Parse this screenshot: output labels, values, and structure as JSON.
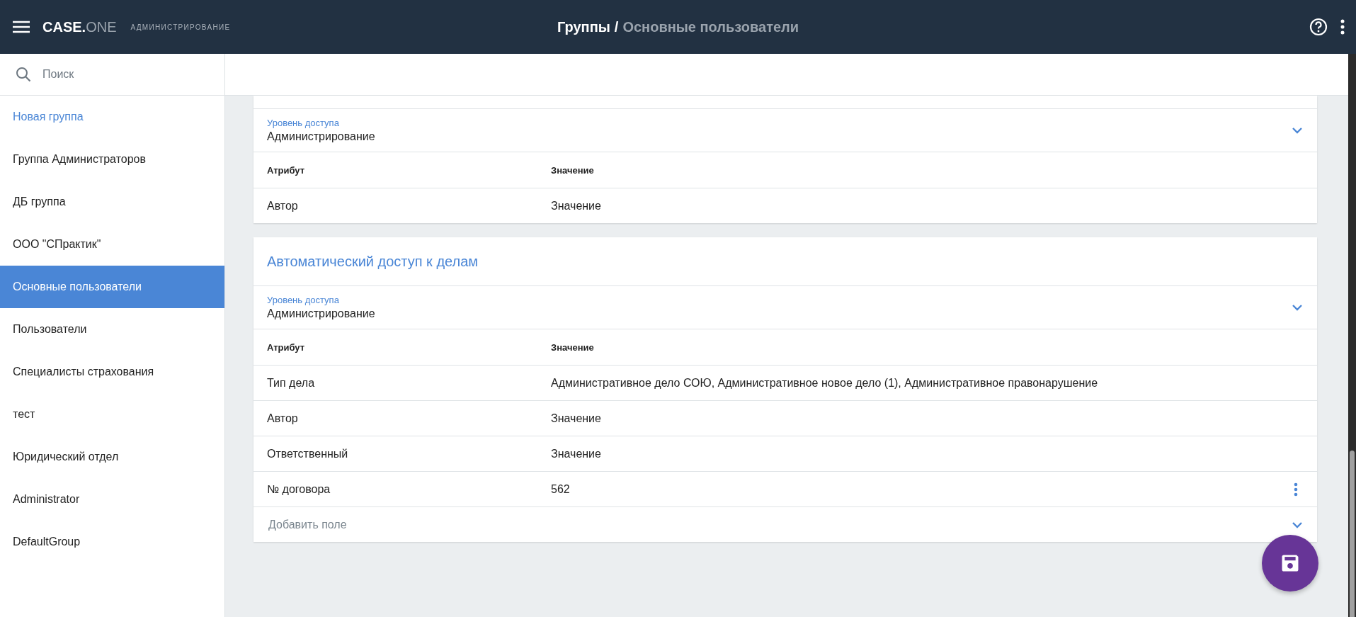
{
  "header": {
    "logo": {
      "main": "CASE.",
      "accent": "ONE"
    },
    "subtitle": "АДМИНИСТРИРОВАНИЕ",
    "breadcrumb": {
      "parent": "Группы",
      "separator": "/",
      "current": "Основные пользователи"
    }
  },
  "sidebar": {
    "search": {
      "placeholder": "Поиск"
    },
    "new_group": "Новая группа",
    "groups": [
      {
        "label": "Группа Администраторов",
        "selected": false
      },
      {
        "label": "ДБ группа",
        "selected": false
      },
      {
        "label": "ООО \"СПрактик\"",
        "selected": false
      },
      {
        "label": "Основные пользователи",
        "selected": true
      },
      {
        "label": "Пользователи",
        "selected": false
      },
      {
        "label": "Специалисты страхования",
        "selected": false
      },
      {
        "label": "тест",
        "selected": false
      },
      {
        "label": "Юридический отдел",
        "selected": false
      },
      {
        "label": "Administrator",
        "selected": false
      },
      {
        "label": "DefaultGroup",
        "selected": false
      }
    ]
  },
  "cards": [
    {
      "access_level": {
        "label": "Уровень доступа",
        "value": "Администрирование"
      },
      "columns": [
        "Атрибут",
        "Значение"
      ],
      "rows": [
        {
          "attribute": "Автор",
          "value": "Значение",
          "menu": false
        }
      ]
    },
    {
      "title": "Автоматический доступ к делам",
      "access_level": {
        "label": "Уровень доступа",
        "value": "Администрирование"
      },
      "columns": [
        "Атрибут",
        "Значение"
      ],
      "rows": [
        {
          "attribute": "Тип дела",
          "value": "Административное дело СОЮ, Административное новое дело (1), Административное правонарушение",
          "menu": false
        },
        {
          "attribute": "Автор",
          "value": "Значение",
          "menu": false
        },
        {
          "attribute": "Ответственный",
          "value": "Значение",
          "menu": false
        },
        {
          "attribute": "№ договора",
          "value": "562",
          "menu": true
        }
      ],
      "add_field": {
        "placeholder": "Добавить поле"
      }
    }
  ]
}
